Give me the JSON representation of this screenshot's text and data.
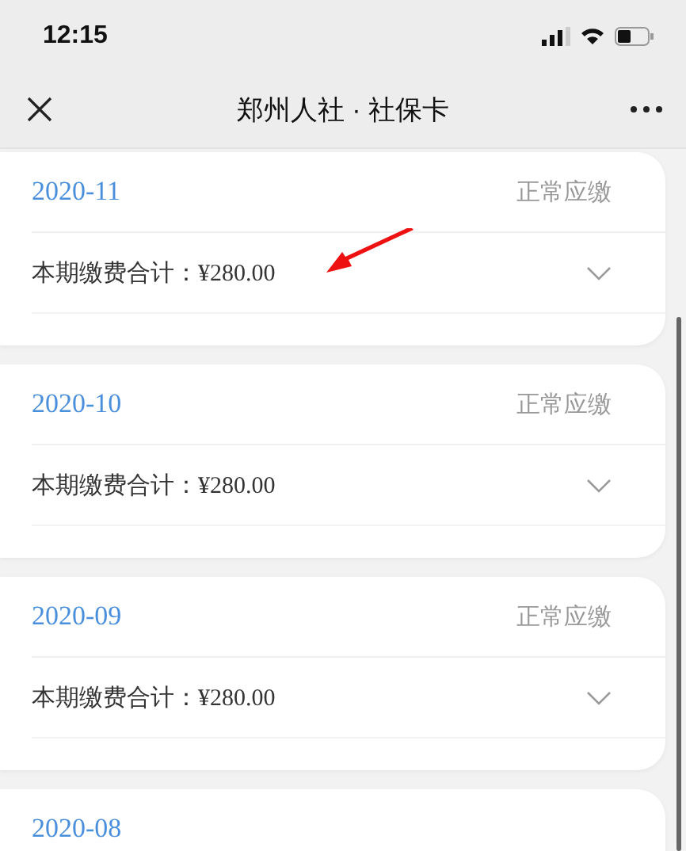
{
  "status_bar": {
    "time": "12:15"
  },
  "nav_bar": {
    "title": "郑州人社 · 社保卡"
  },
  "records": [
    {
      "period": "2020-11",
      "status": "正常应缴",
      "total": "本期缴费合计：¥280.00",
      "expanded": false,
      "annotated": true
    },
    {
      "period": "2020-10",
      "status": "正常应缴",
      "total": "本期缴费合计：¥280.00",
      "expanded": false,
      "annotated": false
    },
    {
      "period": "2020-09",
      "status": "正常应缴",
      "total": "本期缴费合计：¥280.00",
      "expanded": false,
      "annotated": false
    },
    {
      "period": "2020-08"
    }
  ]
}
